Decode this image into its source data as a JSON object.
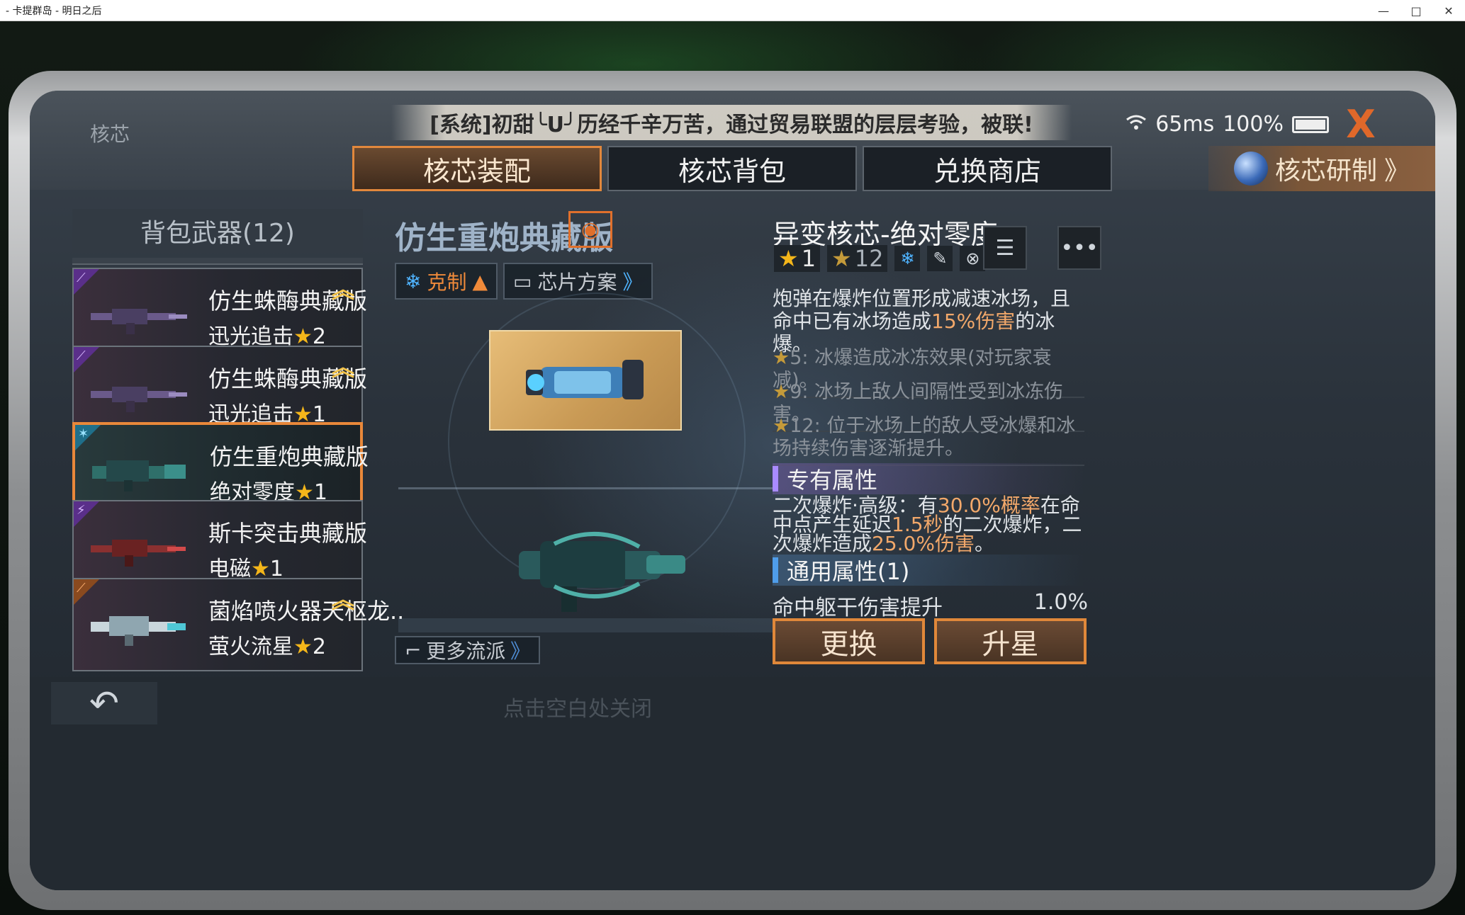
{
  "window": {
    "title": "- 卡提群岛 - 明日之后",
    "controls": [
      "—",
      "□",
      "✕"
    ]
  },
  "header": {
    "section_title": "核芯",
    "marquee": "[系统]初甜╰U╯历经千辛万苦，通过贸易联盟的层层考验，被联!",
    "ping": "65ms",
    "battery": "100%",
    "close_label": "X"
  },
  "tabs": [
    {
      "label": "核芯装配",
      "active": true
    },
    {
      "label": "核芯背包",
      "active": false
    },
    {
      "label": "兑换商店",
      "active": false
    }
  ],
  "research": {
    "label": "核芯研制",
    "arrow": "》"
  },
  "weapon_list": {
    "header": "背包武器(12)",
    "items": [
      {
        "name": "仿生蛛酶典藏版",
        "core": "迅光追击",
        "stars": "2",
        "upgrade": true,
        "selected": false,
        "corner_color": "#5a2f8a"
      },
      {
        "name": "仿生蛛酶典藏版",
        "core": "迅光追击",
        "stars": "1",
        "upgrade": true,
        "selected": false,
        "corner_color": "#5a2f8a"
      },
      {
        "name": "仿生重炮典藏版",
        "core": "绝对零度",
        "stars": "1",
        "upgrade": false,
        "selected": true,
        "corner_color": "#1f6f8a"
      },
      {
        "name": "斯卡突击典藏版",
        "core": "电磁",
        "stars": "1",
        "upgrade": false,
        "selected": false,
        "corner_color": "#5a2f8a"
      },
      {
        "name": "菌焰喷火器天枢龙..",
        "core": "萤火流星",
        "stars": "2",
        "upgrade": true,
        "selected": false,
        "corner_color": "#8a4a1f"
      }
    ]
  },
  "center": {
    "weapon_title": "仿生重炮典藏版",
    "counter_label": "克制",
    "chip_plan_label": "芯片方案",
    "more_label": "更多流派"
  },
  "core": {
    "name": "异变核芯-绝对零度",
    "star_level": "1",
    "star_max": "12",
    "description_parts": [
      "炮弹在爆炸位置形成减速冰场，且命中已有冰场造成",
      "15%伤害",
      "的冰爆。"
    ],
    "tiers": [
      "5: 冰爆造成冰冻效果(对玩家衰减)。",
      "9: 冰场上敌人间隔性受到冰冻伤害。",
      "12: 位于冰场上的敌人受冰爆和冰场持续伤害逐渐提升。"
    ],
    "exclusive_header": "专有属性",
    "exclusive_parts": [
      "二次爆炸·高级：有",
      "30.0%概率",
      "在命中点产生延迟",
      "1.5秒",
      "的二次爆炸，二次爆炸造成",
      "25.0%伤害",
      "。"
    ],
    "general_header": "通用属性(1)",
    "general_label": "命中躯干伤害提升",
    "general_value": "1.0%"
  },
  "actions": {
    "replace": "更换",
    "upgrade": "升星"
  },
  "footer": {
    "back_glyph": "↶",
    "close_hint": "点击空白处关闭"
  },
  "colors": {
    "accent_orange": "#e0883a",
    "star_gold": "#f4b61a",
    "highlight": "#f2a86a",
    "ice_blue": "#4fb4ff"
  }
}
